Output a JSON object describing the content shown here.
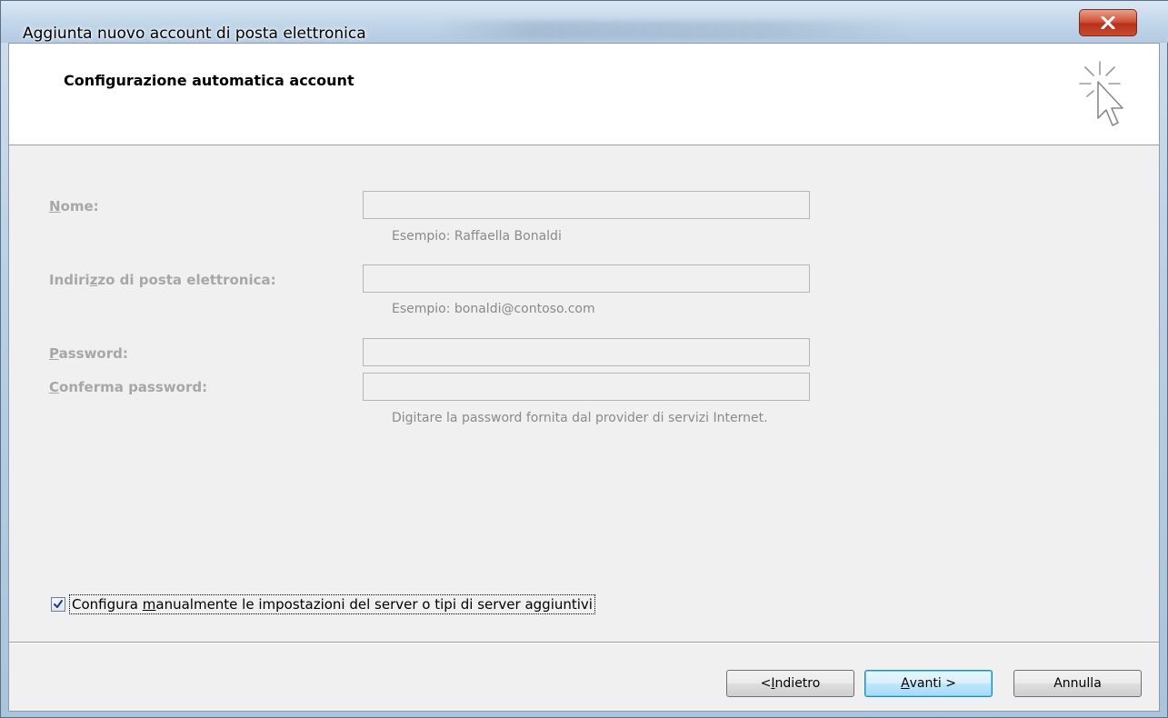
{
  "window": {
    "title": "Aggiunta nuovo account di posta elettronica",
    "close_symbol": "close-icon"
  },
  "header": {
    "title": "Configurazione automatica account",
    "icon": "cursor-click-icon"
  },
  "form": {
    "name": {
      "label_accel": "N",
      "label_rest": "ome:",
      "value": "",
      "hint": "Esempio: Raffaella Bonaldi"
    },
    "email": {
      "label_pre": "Indiri",
      "label_accel": "z",
      "label_rest": "zo di posta elettronica:",
      "value": "",
      "hint": "Esempio: bonaldi@contoso.com"
    },
    "password": {
      "label_accel": "P",
      "label_rest": "assword:",
      "value": ""
    },
    "confirm_password": {
      "label_accel": "C",
      "label_rest": "onferma password:",
      "value": "",
      "hint": "Digitare la password fornita dal provider di servizi Internet."
    }
  },
  "manual_config": {
    "checked": true,
    "label_pre": "Configura ",
    "label_accel": "m",
    "label_rest": "anualmente le impostazioni del server o tipi di server aggiuntivi"
  },
  "buttons": {
    "back": {
      "pre": "< ",
      "accel": "I",
      "rest": "ndietro"
    },
    "next": {
      "accel": "A",
      "rest": "vanti >"
    },
    "cancel": {
      "label": "Annulla"
    }
  }
}
